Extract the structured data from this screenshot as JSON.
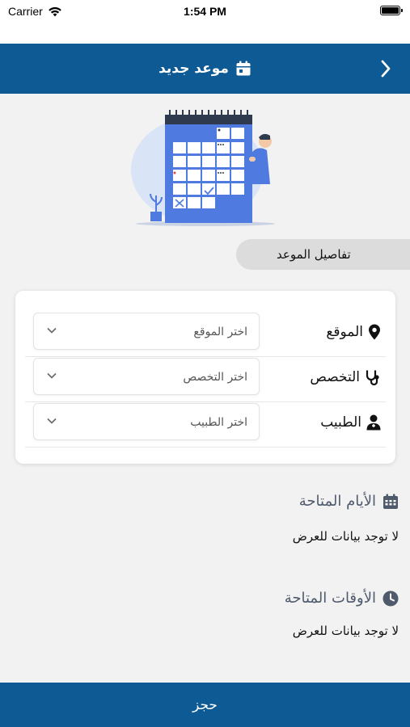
{
  "status_bar": {
    "carrier": "Carrier",
    "time": "1:54 PM",
    "icons": [
      "wifi-icon",
      "battery-icon"
    ]
  },
  "nav": {
    "title": "موعد جديد",
    "title_icon": "calendar-icon",
    "back_icon": "chevron-right-icon"
  },
  "illustration": {
    "icon": "calendar-illustration"
  },
  "section": {
    "label": "تفاصيل الموعد"
  },
  "form": {
    "rows": [
      {
        "label": "الموقع",
        "icon": "location-pin-icon",
        "placeholder": "اختر الموقع"
      },
      {
        "label": "التخصص",
        "icon": "stethoscope-icon",
        "placeholder": "اختر التخصص"
      },
      {
        "label": "الطبيب",
        "icon": "doctor-icon",
        "placeholder": "اختر الطبيب"
      }
    ]
  },
  "available_days": {
    "title": "الأيام المتاحة",
    "icon": "calendar-grid-icon",
    "empty": "لا توجد بيانات للعرض"
  },
  "available_times": {
    "title": "الأوقات المتاحة",
    "icon": "clock-icon",
    "empty": "لا توجد بيانات للعرض"
  },
  "book_button": {
    "label": "حجز"
  },
  "colors": {
    "primary": "#0d5a94",
    "background": "#f2f2f2",
    "illustration_blue": "#4f7be0",
    "muted_text": "#4f5a6c"
  }
}
